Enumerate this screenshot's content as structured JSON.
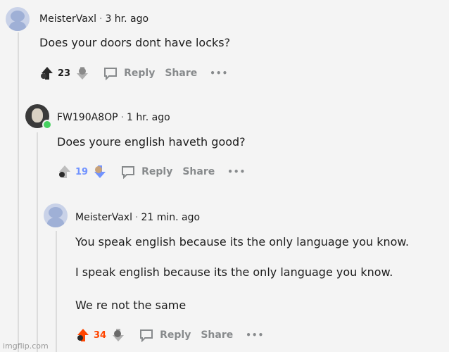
{
  "comments": [
    {
      "username": "MeisterVaxl",
      "time": "3 hr. ago",
      "lines": [
        "Does your doors dont have locks?"
      ],
      "score": "23",
      "reply_label": "Reply",
      "share_label": "Share",
      "more_label": "•••",
      "vote_state": "upvoted-dark"
    },
    {
      "username": "FW190A8OP",
      "time": "1 hr. ago",
      "lines": [
        "Does youre english haveth good?"
      ],
      "score": "19",
      "reply_label": "Reply",
      "share_label": "Share",
      "more_label": "•••",
      "vote_state": "downvoted"
    },
    {
      "username": "MeisterVaxl",
      "time": "21 min. ago",
      "lines": [
        "You speak english because its the only language you know.",
        "I speak english because its the only language you know.",
        "We re not the same"
      ],
      "score": "34",
      "reply_label": "Reply",
      "share_label": "Share",
      "more_label": "•••",
      "vote_state": "upvoted"
    }
  ],
  "watermark": "imgflip.com",
  "colors": {
    "upvote": "#ff4500",
    "downvote": "#7193ff",
    "muted": "#878a8c",
    "online": "#46d160"
  }
}
